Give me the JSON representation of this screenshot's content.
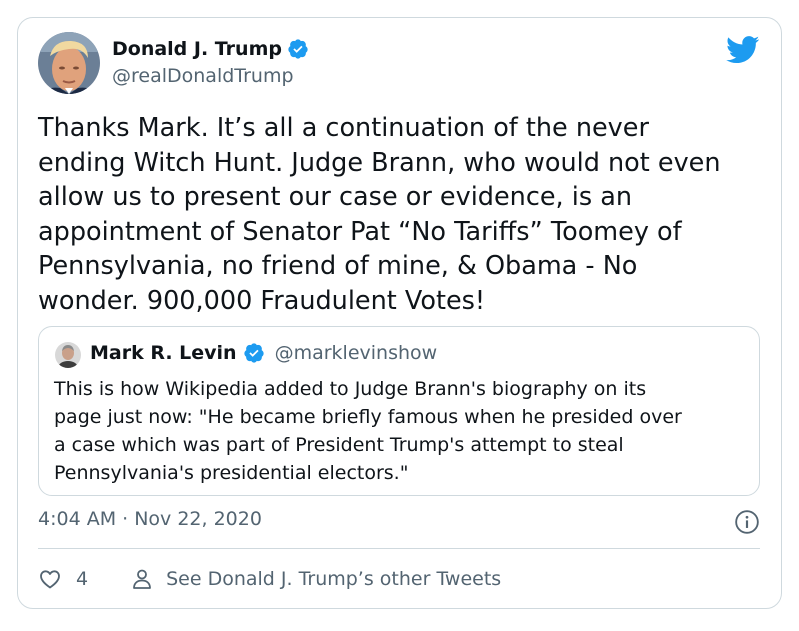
{
  "tweet": {
    "author_name": "Donald J. Trump",
    "author_handle": "@realDonaldTrump",
    "text": "Thanks Mark. It’s all a continuation of the never\nending Witch Hunt. Judge Brann, who would not even\nallow us to present our case or evidence, is an\nappointment of Senator Pat “No Tariffs” Toomey of\nPennsylvania, no friend of mine, & Obama - No\nwonder. 900,000 Fraudulent Votes!",
    "timestamp": "4:04 AM · Nov 22, 2020",
    "like_count": "4",
    "see_more_label": "See Donald J. Trump’s other Tweets"
  },
  "quote": {
    "author_name": "Mark R. Levin",
    "author_handle": "@marklevinshow",
    "text": "This is how Wikipedia added to Judge Brann's biography on its\npage just now: \"He became briefly famous when he presided over\na case which was part of President Trump's attempt to steal\nPennsylvania's presidential electors.\""
  },
  "icons": {
    "brand": "twitter-bird-icon",
    "verified": "verified-badge-icon",
    "info": "info-icon",
    "like": "heart-icon",
    "profile": "person-icon"
  },
  "colors": {
    "brand_blue": "#1d9bf0",
    "text_primary": "#0f1419",
    "text_secondary": "#536471",
    "border": "#cfd9de"
  }
}
